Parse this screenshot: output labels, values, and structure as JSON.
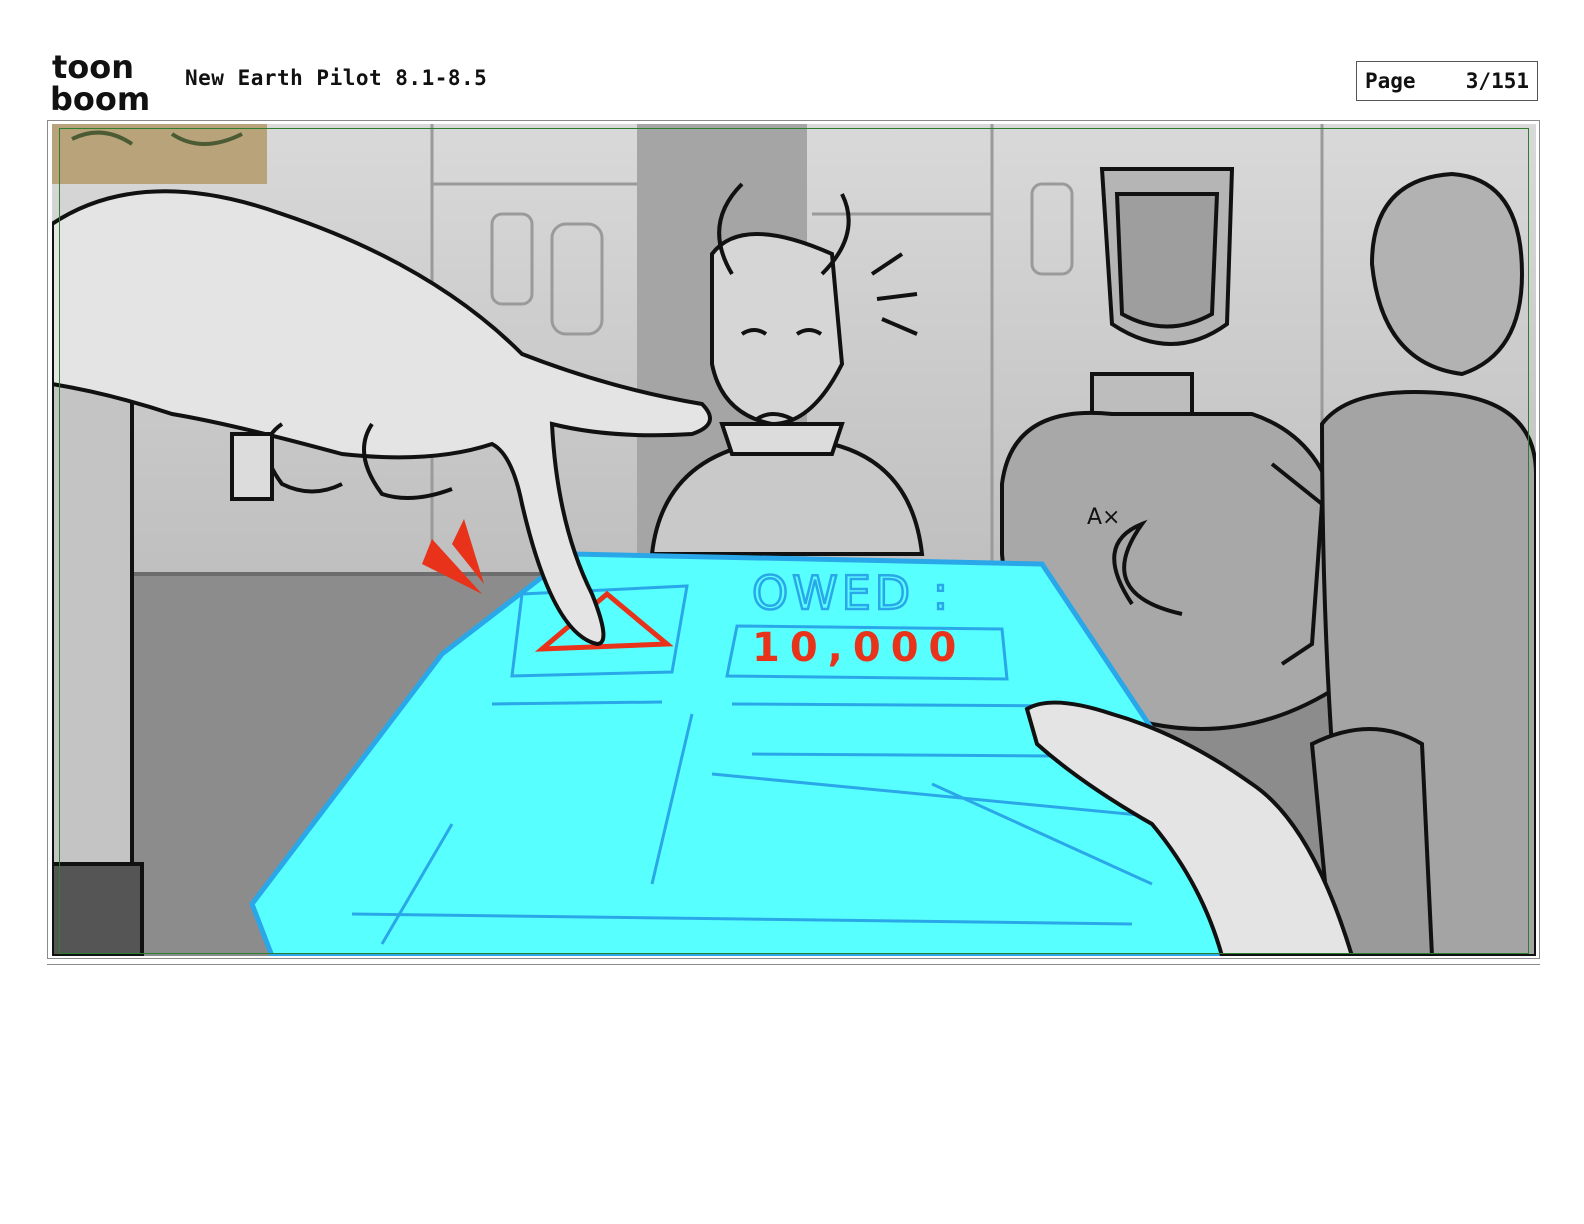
{
  "header": {
    "brand_line1": "toon",
    "brand_line2": "boom",
    "title": "New Earth Pilot 8.1-8.5",
    "page_label": "Page",
    "page_value": "3/151"
  },
  "panel": {
    "screen_heading": "OWED :",
    "screen_amount": "10,000",
    "badge_text": "A×"
  },
  "colors": {
    "screen": "#58ffff",
    "screen_lines": "#2aa7e8",
    "accent_red": "#e8321a",
    "skin": "#e4e4e4",
    "background_gray": "#b8b8b8",
    "safe_frame": "#2f7d2f"
  }
}
